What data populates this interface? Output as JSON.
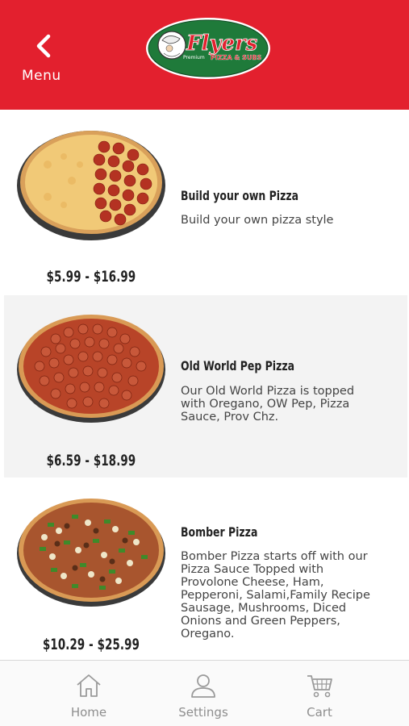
{
  "header": {
    "back_label": "Menu",
    "logo_main": "Flyers",
    "logo_sub": "PIZZA & SUBS",
    "logo_premium": "Premium",
    "brand_red": "#e3202e",
    "logo_green": "#1f7a3a"
  },
  "menu_items": [
    {
      "name": "Build your own Pizza",
      "description": "Build your own pizza style",
      "price": "$5.99 - $16.99"
    },
    {
      "name": "Old World Pep Pizza",
      "description_lines": [
        "Our Old World Pizza is topped",
        "with Oregano, OW Pep, Pizza",
        "Sauce, Prov Chz."
      ],
      "price": "$6.59 - $18.99"
    },
    {
      "name": "Bomber Pizza",
      "description_lines": [
        "Bomber Pizza starts off with our",
        "Pizza Sauce Topped with",
        "Provolone Cheese, Ham,",
        "Pepperoni, Salami,Family Recipe",
        "Sausage, Mushrooms, Diced",
        "Onions and Green Peppers,",
        "Oregano."
      ],
      "price": "$10.29 - $25.99"
    }
  ],
  "tabbar": {
    "home_label": "Home",
    "settings_label": "Settings",
    "cart_label": "Cart"
  }
}
